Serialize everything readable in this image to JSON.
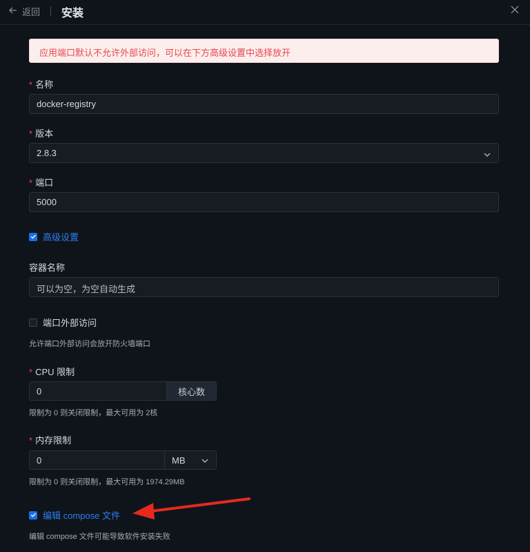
{
  "header": {
    "back_label": "返回",
    "title": "安装"
  },
  "alert": {
    "text": "应用端口默认不允许外部访问，可以在下方高级设置中选择放开"
  },
  "form": {
    "name": {
      "label": "名称",
      "value": "docker-registry"
    },
    "version": {
      "label": "版本",
      "value": "2.8.3"
    },
    "port": {
      "label": "端口",
      "value": "5000"
    },
    "advanced": {
      "label": "高级设置",
      "checked": true
    },
    "container_name": {
      "label": "容器名称",
      "placeholder": "可以为空，为空自动生成"
    },
    "external_access": {
      "label": "端口外部访问",
      "checked": false,
      "hint": "允许端口外部访问会放开防火墙端口"
    },
    "cpu_limit": {
      "label": "CPU 限制",
      "value": "0",
      "unit": "核心数",
      "hint": "限制为 0 则关闭限制，最大可用为 2核"
    },
    "memory_limit": {
      "label": "内存限制",
      "value": "0",
      "unit": "MB",
      "hint": "限制为 0 则关闭限制，最大可用为 1974.29MB"
    },
    "edit_compose": {
      "label": "编辑 compose 文件",
      "checked": true,
      "hint": "编辑 compose 文件可能导致软件安装失败"
    }
  },
  "colors": {
    "background": "#0f141b",
    "accent": "#1a6fe8",
    "required": "#e5484d",
    "annotation_arrow": "#e8281e"
  },
  "icons": {
    "back": "arrow-left-icon",
    "close": "close-icon",
    "select": "chevron-down-icon",
    "check": "check-icon",
    "annotation": "red-arrow-annotation"
  }
}
